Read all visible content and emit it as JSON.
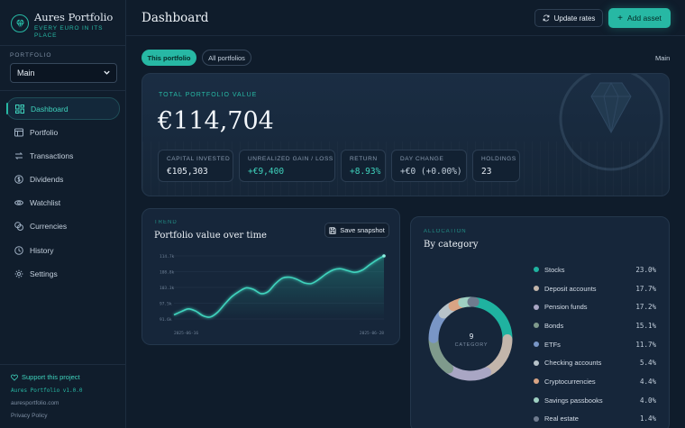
{
  "brand": {
    "title": "Aures Portfolio",
    "tagline": "EVERY EURO IN ITS PLACE",
    "logo_icon": "gem-icon"
  },
  "portfolio": {
    "label": "PORTFOLIO",
    "selected": "Main"
  },
  "nav": [
    {
      "label": "Dashboard",
      "icon": "dashboard-icon",
      "active": true
    },
    {
      "label": "Portfolio",
      "icon": "portfolio-icon"
    },
    {
      "label": "Transactions",
      "icon": "transactions-icon"
    },
    {
      "label": "Dividends",
      "icon": "dividends-icon"
    },
    {
      "label": "Watchlist",
      "icon": "eye-icon"
    },
    {
      "label": "Currencies",
      "icon": "coins-icon"
    },
    {
      "label": "History",
      "icon": "clock-icon"
    },
    {
      "label": "Settings",
      "icon": "gear-icon"
    }
  ],
  "sidebar_footer": {
    "support": "Support this project",
    "version": "Aures Portfolio v1.0.0",
    "site": "auresportfolio.com",
    "privacy": "Privacy Policy"
  },
  "header": {
    "title": "Dashboard",
    "update_label": "Update rates",
    "add_label": "Add asset"
  },
  "filters": {
    "this": "This portfolio",
    "all": "All portfolios",
    "current": "Main"
  },
  "summary": {
    "label": "TOTAL PORTFOLIO VALUE",
    "value": "€114,704",
    "stats": [
      {
        "label": "CAPITAL INVESTED",
        "value": "€105,303",
        "color": "#e6edf5"
      },
      {
        "label": "UNREALIZED GAIN / LOSS",
        "value": "+€9,400",
        "color": "#3fd3bd"
      },
      {
        "label": "RETURN",
        "value": "+8.93%",
        "color": "#3fd3bd"
      },
      {
        "label": "DAY CHANGE",
        "value": "+€0 (+0.00%)",
        "color": "#c3cfdc"
      },
      {
        "label": "HOLDINGS",
        "value": "23",
        "color": "#e6edf5"
      }
    ]
  },
  "trend": {
    "kicker": "TREND",
    "title": "Portfolio value over time",
    "snapshot_label": "Save snapshot"
  },
  "chart_data": {
    "type": "area",
    "title": "Portfolio value over time",
    "ytick_labels": [
      "114.7k",
      "108.8k",
      "103.3k",
      "97.5k",
      "91.6k"
    ],
    "xtick_labels": [
      "2025-06-16",
      "2025-06-28"
    ],
    "ylim": [
      91.6,
      114.7
    ],
    "y": [
      93.1,
      94.3,
      95.3,
      94.5,
      92.8,
      92.3,
      94.0,
      97.0,
      99.8,
      101.7,
      103.0,
      102.4,
      100.9,
      101.6,
      104.5,
      106.6,
      106.9,
      106.1,
      104.8,
      104.6,
      106.1,
      108.1,
      109.6,
      110.0,
      109.3,
      108.7,
      109.5,
      111.4,
      113.2,
      114.7
    ],
    "color": "#3fd3bd"
  },
  "allocation": {
    "kicker": "ALLOCATION",
    "title": "By category",
    "center_number": "9",
    "center_label": "CATEGORY",
    "items": [
      {
        "name": "Stocks",
        "pct": "23.0%",
        "value": 23.0,
        "color": "#1fb3a0"
      },
      {
        "name": "Deposit accounts",
        "pct": "17.7%",
        "value": 17.7,
        "color": "#c3b6ab"
      },
      {
        "name": "Pension funds",
        "pct": "17.2%",
        "value": 17.2,
        "color": "#a9a6c4"
      },
      {
        "name": "Bonds",
        "pct": "15.1%",
        "value": 15.1,
        "color": "#7f9a8c"
      },
      {
        "name": "ETFs",
        "pct": "11.7%",
        "value": 11.7,
        "color": "#7996c6"
      },
      {
        "name": "Checking accounts",
        "pct": "5.4%",
        "value": 5.4,
        "color": "#b7c3c9"
      },
      {
        "name": "Cryptocurrencies",
        "pct": "4.4%",
        "value": 4.4,
        "color": "#d9a484"
      },
      {
        "name": "Savings passbooks",
        "pct": "4.0%",
        "value": 4.0,
        "color": "#9fd0c2"
      },
      {
        "name": "Real estate",
        "pct": "1.4%",
        "value": 1.4,
        "color": "#6f7b8e"
      }
    ]
  }
}
